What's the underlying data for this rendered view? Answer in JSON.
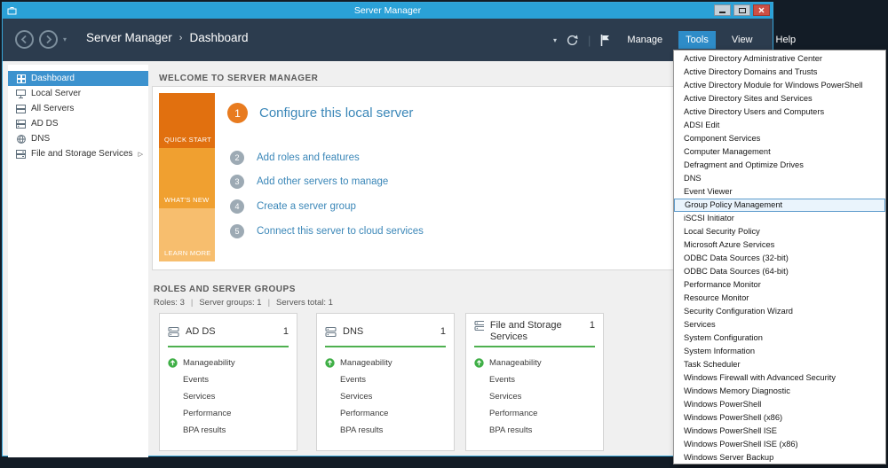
{
  "window": {
    "title": "Server Manager"
  },
  "navbar": {
    "breadcrumb": {
      "root": "Server Manager",
      "separator": "›",
      "current": "Dashboard"
    },
    "menus": [
      {
        "label": "Manage",
        "active": false
      },
      {
        "label": "Tools",
        "active": true
      },
      {
        "label": "View",
        "active": false
      },
      {
        "label": "Help",
        "active": false
      }
    ]
  },
  "icons": {
    "caret_down": "▾",
    "divider": "|",
    "expand_arrow": "▷",
    "panel_collapse": "⌃"
  },
  "sidebar": {
    "items": [
      {
        "label": "Dashboard",
        "selected": true
      },
      {
        "label": "Local Server",
        "selected": false
      },
      {
        "label": "All Servers",
        "selected": false
      },
      {
        "label": "AD DS",
        "selected": false
      },
      {
        "label": "DNS",
        "selected": false
      },
      {
        "label": "File and Storage Services",
        "selected": false,
        "expandable": true
      }
    ]
  },
  "welcome": {
    "header": "WELCOME TO SERVER MANAGER",
    "tiles": [
      {
        "label": "QUICK START"
      },
      {
        "label": "WHAT'S NEW"
      },
      {
        "label": "LEARN MORE"
      }
    ],
    "steps": [
      {
        "num": "1",
        "label": "Configure this local server"
      },
      {
        "num": "2",
        "label": "Add roles and features"
      },
      {
        "num": "3",
        "label": "Add other servers to manage"
      },
      {
        "num": "4",
        "label": "Create a server group"
      },
      {
        "num": "5",
        "label": "Connect this server to cloud services"
      }
    ]
  },
  "roles": {
    "header": "ROLES AND SERVER GROUPS",
    "summary": [
      "Roles: 3",
      "Server groups: 1",
      "Servers total: 1"
    ],
    "summary_divider": "|",
    "cards": [
      {
        "title": "AD DS",
        "count": "1",
        "rows": [
          "Manageability",
          "Events",
          "Services",
          "Performance",
          "BPA results"
        ]
      },
      {
        "title": "DNS",
        "count": "1",
        "rows": [
          "Manageability",
          "Events",
          "Services",
          "Performance",
          "BPA results"
        ]
      },
      {
        "title": "File and Storage Services",
        "count": "1",
        "rows": [
          "Manageability",
          "Events",
          "Services",
          "Performance",
          "BPA results"
        ]
      }
    ]
  },
  "tools_menu": {
    "active_item": "Group Policy Management",
    "items": [
      "Active Directory Administrative Center",
      "Active Directory Domains and Trusts",
      "Active Directory Module for Windows PowerShell",
      "Active Directory Sites and Services",
      "Active Directory Users and Computers",
      "ADSI Edit",
      "Component Services",
      "Computer Management",
      "Defragment and Optimize Drives",
      "DNS",
      "Event Viewer",
      "Group Policy Management",
      "iSCSI Initiator",
      "Local Security Policy",
      "Microsoft Azure Services",
      "ODBC Data Sources (32-bit)",
      "ODBC Data Sources (64-bit)",
      "Performance Monitor",
      "Resource Monitor",
      "Security Configuration Wizard",
      "Services",
      "System Configuration",
      "System Information",
      "Task Scheduler",
      "Windows Firewall with Advanced Security",
      "Windows Memory Diagnostic",
      "Windows PowerShell",
      "Windows PowerShell (x86)",
      "Windows PowerShell ISE",
      "Windows PowerShell ISE (x86)",
      "Windows Server Backup"
    ]
  },
  "colors": {
    "titlebar": "#2aa1d7",
    "navbar": "#2c3c4e",
    "selection_blue": "#3c92ce",
    "quick_start_orange": "#e1700f",
    "whats_new_orange": "#f0a030",
    "learn_more_orange": "#f7be6e",
    "link_blue": "#3b87b8",
    "status_green": "#4eb050",
    "close_red": "#cc4f44"
  }
}
